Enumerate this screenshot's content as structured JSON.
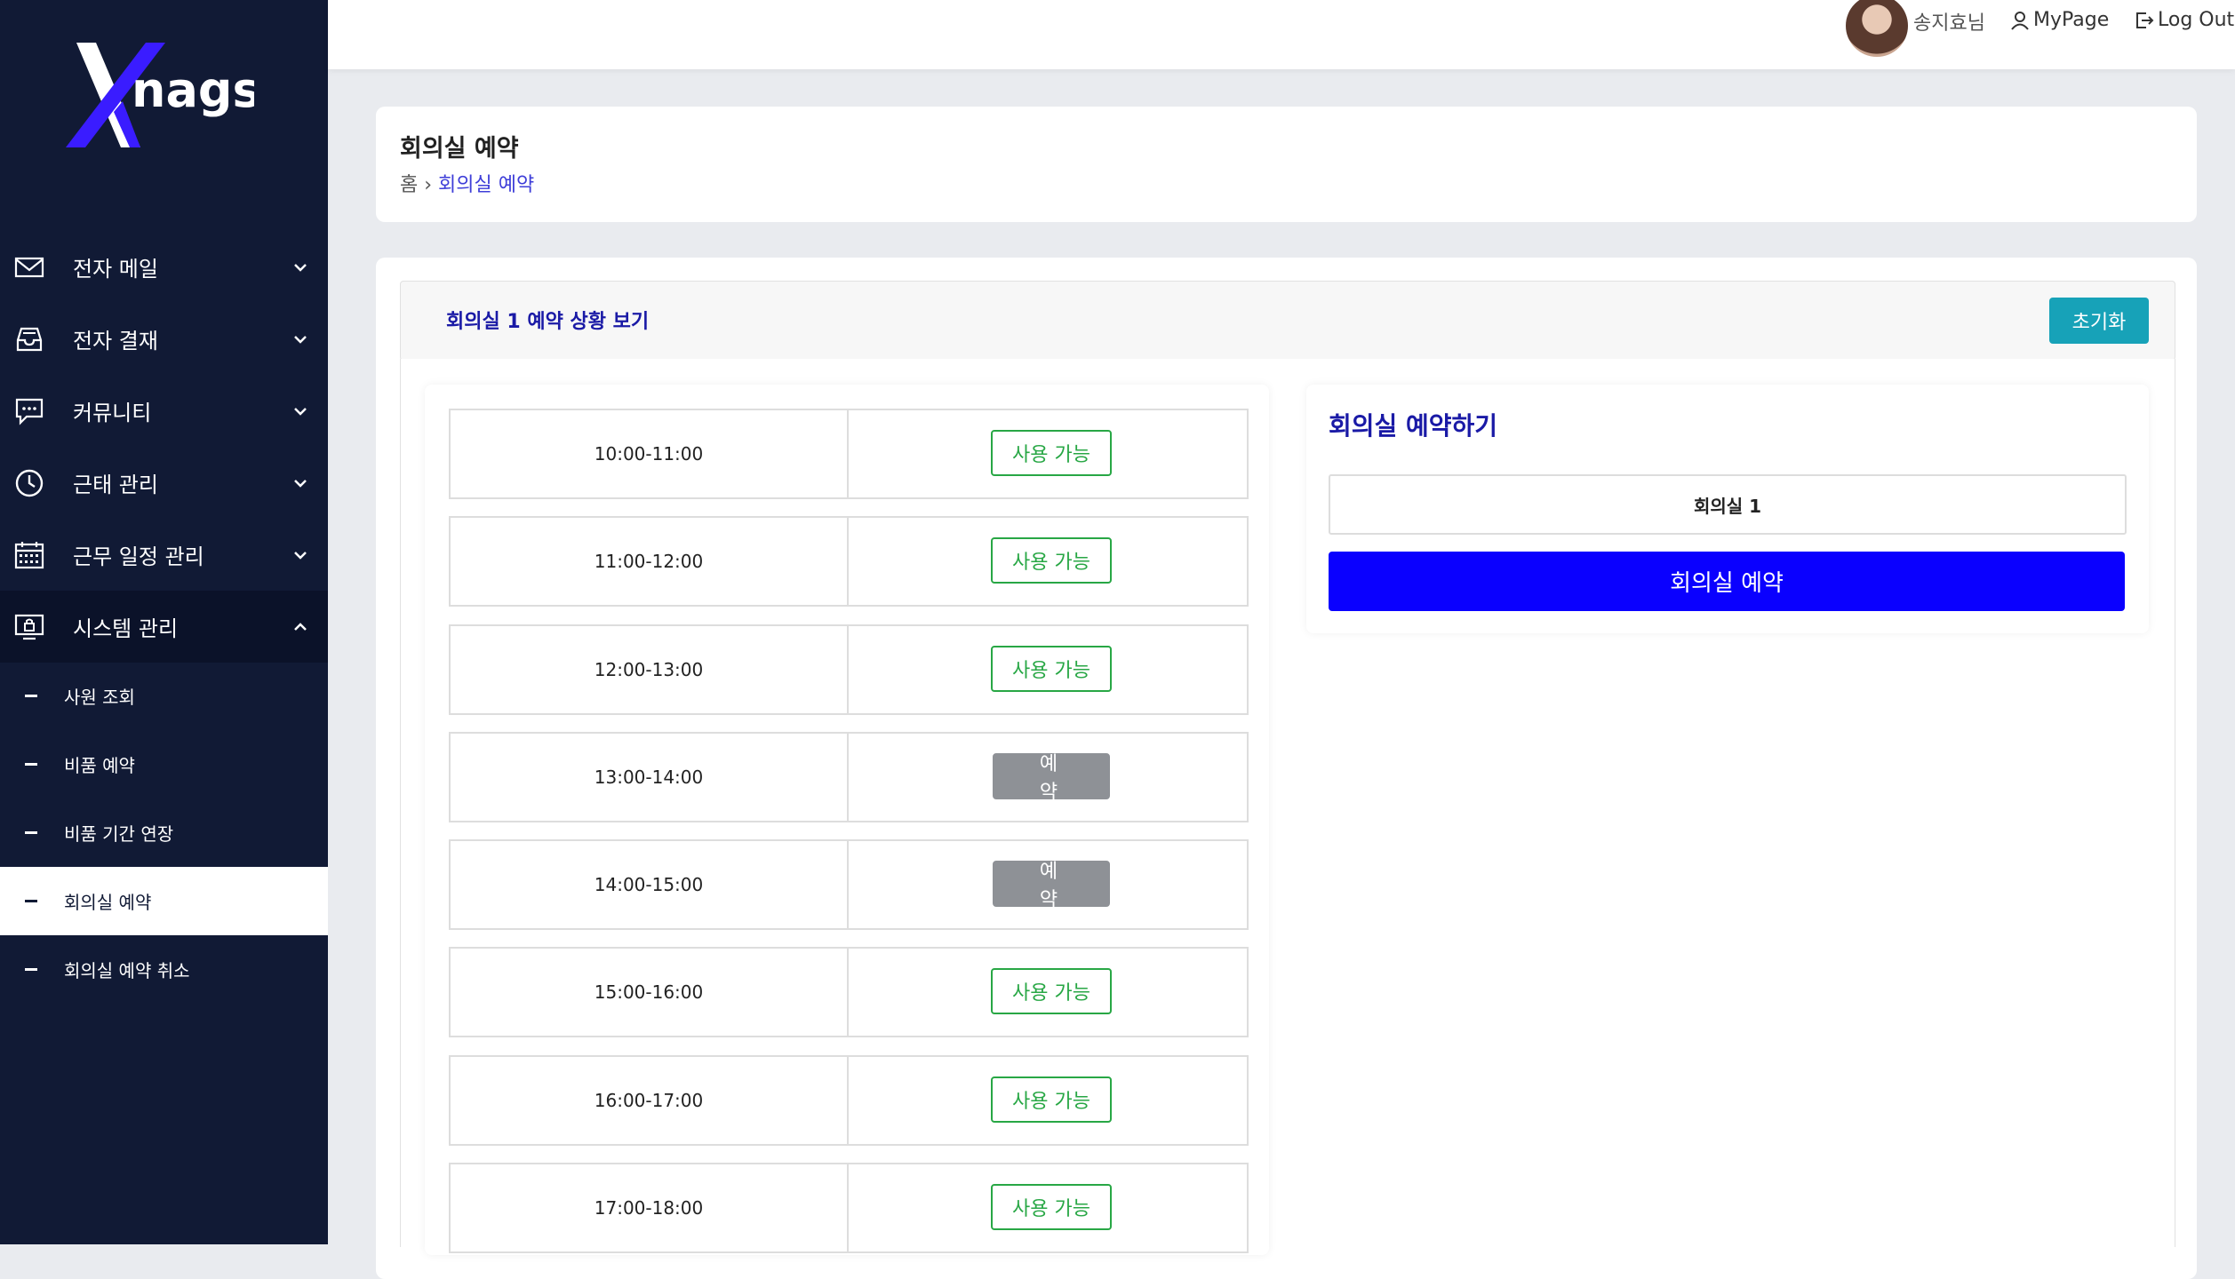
{
  "brand": {
    "logo_text": "nags"
  },
  "sidebar": {
    "items": [
      {
        "label": "전자 메일",
        "icon": "mail-icon"
      },
      {
        "label": "전자 결재",
        "icon": "inbox-tray-icon"
      },
      {
        "label": "커뮤니티",
        "icon": "chat-icon"
      },
      {
        "label": "근태 관리",
        "icon": "clock-icon"
      },
      {
        "label": "근무 일정 관리",
        "icon": "calendar-icon"
      },
      {
        "label": "시스템 관리",
        "icon": "monitor-lock-icon"
      }
    ],
    "sub_items": [
      {
        "label": "사원 조회"
      },
      {
        "label": "비품 예약"
      },
      {
        "label": "비품 기간 연장"
      },
      {
        "label": "회의실 예약"
      },
      {
        "label": "회의실 예약 취소"
      }
    ]
  },
  "topbar": {
    "user_name": "송지효님",
    "mypage_label": "MyPage",
    "logout_label": "Log Out"
  },
  "page": {
    "title": "회의실 예약",
    "breadcrumb_home": "홈",
    "breadcrumb_current": "회의실 예약"
  },
  "panel": {
    "title": "회의실 1 예약 상황 보기",
    "reset_label": "초기화"
  },
  "slots": [
    {
      "time": "10:00-11:00",
      "status": "사용 가능"
    },
    {
      "time": "11:00-12:00",
      "status": "사용 가능"
    },
    {
      "time": "12:00-13:00",
      "status": "사용 가능"
    },
    {
      "time": "13:00-14:00",
      "status": "예약"
    },
    {
      "time": "14:00-15:00",
      "status": "예약"
    },
    {
      "time": "15:00-16:00",
      "status": "사용 가능"
    },
    {
      "time": "16:00-17:00",
      "status": "사용 가능"
    },
    {
      "time": "17:00-18:00",
      "status": "사용 가능"
    }
  ],
  "booking": {
    "title": "회의실 예약하기",
    "room": "회의실 1",
    "submit_label": "회의실 예약"
  },
  "colors": {
    "sidebar": "#111a35",
    "accent": "#0a00ff",
    "available": "#28a745",
    "booked": "#8e9196",
    "reset": "#17a2b8"
  }
}
